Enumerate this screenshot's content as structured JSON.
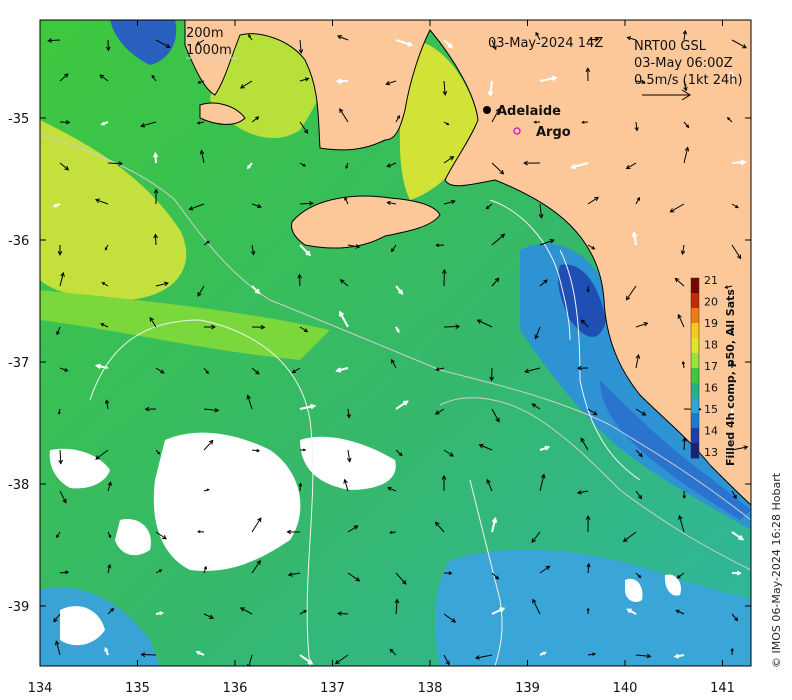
{
  "map": {
    "date_title": "03-May-2024 14Z",
    "product": "NRT00 GSL",
    "current_time": "03-May 06:00Z",
    "arrow_scale_label": "0.5m/s (1kt 24h)",
    "isobath_labels": [
      "200m",
      "1000m"
    ],
    "places": [
      {
        "name": "Adelaide",
        "marker": "filled-circle",
        "color": "#000000",
        "lon": 138.6,
        "lat": -34.93
      },
      {
        "name": "Argo",
        "marker": "open-circle",
        "color": "#d020d0",
        "lon": 138.87,
        "lat": -35.12
      }
    ],
    "lon_ticks": [
      "134",
      "135",
      "136",
      "137",
      "138",
      "139",
      "140",
      "141"
    ],
    "lat_ticks": [
      "-35",
      "-36",
      "-37",
      "-38",
      "-39"
    ],
    "colorbar": {
      "label": "Filled 4h comp, p50, All Sats",
      "ticks": [
        "21",
        "20",
        "19",
        "18",
        "17",
        "16",
        "15",
        "14",
        "13"
      ],
      "colors": [
        "#7a0403",
        "#c42a05",
        "#f07b14",
        "#f6c822",
        "#dde431",
        "#99e33a",
        "#3ec83d",
        "#22b289",
        "#30a5d1",
        "#1b78d6",
        "#1e3fa8",
        "#13247a"
      ]
    },
    "land_color": "#fcc89a",
    "cloud_color": "#ffffff",
    "copyright": "© IMOS 06-May-2024 16:28 Hobart"
  }
}
